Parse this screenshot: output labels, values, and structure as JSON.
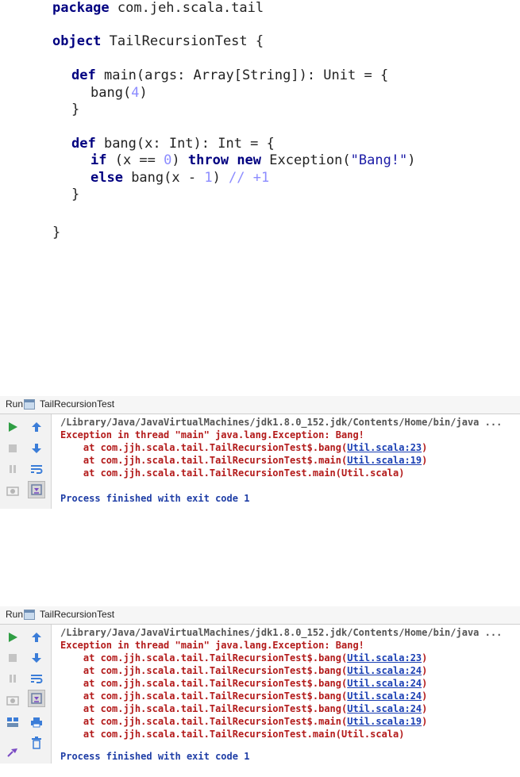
{
  "code": {
    "line1_kw": "package",
    "line1_rest": " com.jeh.scala.tail",
    "line2_kw": "object",
    "line2_rest": " TailRecursionTest {",
    "line3_kw": "def",
    "line3_rest": " main(args: Array[String]): Unit = {",
    "line4_pre": "bang(",
    "line4_num": "4",
    "line4_post": ")",
    "line5": "}",
    "line6_kw": "def",
    "line6_rest": " bang(x: Int): Int = {",
    "line7_kw1": "if",
    "line7_a": " (x == ",
    "line7_num": "0",
    "line7_b": ") ",
    "line7_kw2": "throw",
    "line7_sp": " ",
    "line7_kw3": "new",
    "line7_c": " Exception(",
    "line7_str": "\"Bang!\"",
    "line7_d": ")",
    "line8_kw": "else",
    "line8_a": " bang(x - ",
    "line8_num": "1",
    "line8_b": ") ",
    "line8_cm": "// +1",
    "line9": "}",
    "line10": "}"
  },
  "run1": {
    "run_label": "Run",
    "tab_title": "TailRecursionTest",
    "java_path": "/Library/Java/JavaVirtualMachines/jdk1.8.0_152.jdk/Contents/Home/bin/java ...",
    "exception": "Exception in thread \"main\" java.lang.Exception: Bang!",
    "frames": [
      {
        "text": "    at com.jjh.scala.tail.TailRecursionTest$.bang(",
        "link": "Util.scala:23",
        "end": ")"
      },
      {
        "text": "    at com.jjh.scala.tail.TailRecursionTest$.main(",
        "link": "Util.scala:19",
        "end": ")"
      },
      {
        "text": "    at com.jjh.scala.tail.TailRecursionTest.main(Util.scala)",
        "link": "",
        "end": ""
      }
    ],
    "finished": "Process finished with exit code 1"
  },
  "run2": {
    "run_label": "Run",
    "tab_title": "TailRecursionTest",
    "java_path": "/Library/Java/JavaVirtualMachines/jdk1.8.0_152.jdk/Contents/Home/bin/java ...",
    "exception": "Exception in thread \"main\" java.lang.Exception: Bang!",
    "frames": [
      {
        "text": "    at com.jjh.scala.tail.TailRecursionTest$.bang(",
        "link": "Util.scala:23",
        "end": ")"
      },
      {
        "text": "    at com.jjh.scala.tail.TailRecursionTest$.bang(",
        "link": "Util.scala:24",
        "end": ")"
      },
      {
        "text": "    at com.jjh.scala.tail.TailRecursionTest$.bang(",
        "link": "Util.scala:24",
        "end": ")"
      },
      {
        "text": "    at com.jjh.scala.tail.TailRecursionTest$.bang(",
        "link": "Util.scala:24",
        "end": ")"
      },
      {
        "text": "    at com.jjh.scala.tail.TailRecursionTest$.bang(",
        "link": "Util.scala:24",
        "end": ")"
      },
      {
        "text": "    at com.jjh.scala.tail.TailRecursionTest$.main(",
        "link": "Util.scala:19",
        "end": ")"
      },
      {
        "text": "    at com.jjh.scala.tail.TailRecursionTest.main(Util.scala)",
        "link": "",
        "end": ""
      }
    ],
    "finished": "Process finished with exit code 1"
  },
  "icons": {
    "rerun": "rerun-icon",
    "up": "up-arrow-icon",
    "stop": "stop-icon",
    "down": "down-arrow-icon",
    "pause": "pause-icon",
    "softwrap": "soft-wrap-icon",
    "camera": "dump-threads-icon",
    "scroll": "scroll-to-end-icon",
    "layout": "restore-layout-icon",
    "print": "print-icon",
    "trash": "clear-all-icon",
    "pin": "pin-icon"
  },
  "colors": {
    "keyword": "#000080",
    "number": "#8c8cff",
    "string": "#1a1aa6",
    "error": "#b31a1a",
    "link": "#1a3fb3",
    "run_green": "#2f9e44"
  }
}
